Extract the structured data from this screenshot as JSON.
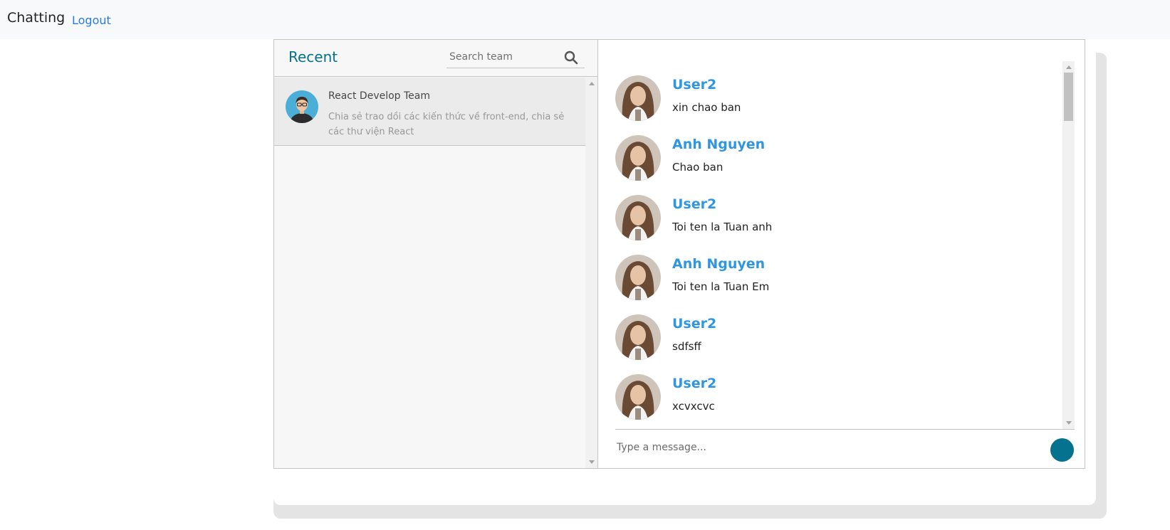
{
  "navbar": {
    "brand": "Chatting",
    "logout_label": "Logout"
  },
  "sidebar": {
    "title": "Recent",
    "search_placeholder": "Search team",
    "teams": [
      {
        "name": "React Develop Team",
        "description": "Chia sẻ trao dồi các kiến thức về front-end, chia sẻ các thư viện React"
      }
    ]
  },
  "messages": [
    {
      "user": "User2",
      "text": "xin chao ban"
    },
    {
      "user": "Anh Nguyen",
      "text": "Chao ban"
    },
    {
      "user": "User2",
      "text": "Toi ten la Tuan anh"
    },
    {
      "user": "Anh Nguyen",
      "text": "Toi ten la Tuan Em"
    },
    {
      "user": "User2",
      "text": "sdfsff"
    },
    {
      "user": "User2",
      "text": "xcvxcvc"
    }
  ],
  "composer": {
    "placeholder": "Type a message..."
  },
  "colors": {
    "accent": "#05728f",
    "username": "#2f96e4",
    "link": "#2a7ae2"
  }
}
